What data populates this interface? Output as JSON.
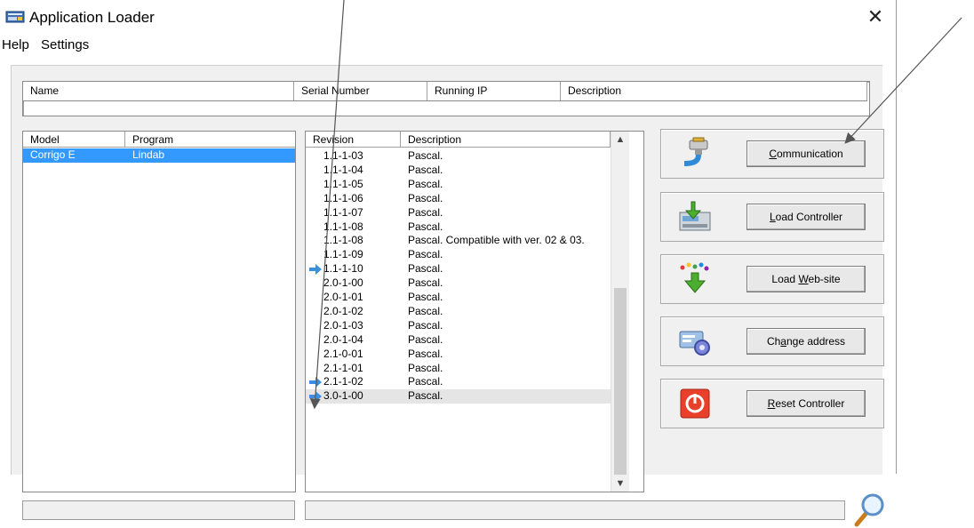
{
  "window": {
    "title": "Application Loader",
    "close_glyph": "✕"
  },
  "menu": [
    "Help",
    "Settings"
  ],
  "device_table": {
    "columns": [
      "Name",
      "Serial Number",
      "Running IP",
      "Description"
    ]
  },
  "model_table": {
    "columns": [
      "Model",
      "Program"
    ],
    "rows": [
      {
        "model": "Corrigo E",
        "program": "Lindab",
        "selected": true
      }
    ]
  },
  "revision_table": {
    "columns": [
      "Revision",
      "Description"
    ],
    "rows": [
      {
        "revision": "1.1-1-03",
        "description": "Pascal.",
        "arrow": false
      },
      {
        "revision": "1.1-1-04",
        "description": "Pascal.",
        "arrow": false
      },
      {
        "revision": "1.1-1-05",
        "description": "Pascal.",
        "arrow": false
      },
      {
        "revision": "1.1-1-06",
        "description": "Pascal.",
        "arrow": false
      },
      {
        "revision": "1.1-1-07",
        "description": "Pascal.",
        "arrow": false
      },
      {
        "revision": "1.1-1-08",
        "description": "Pascal.",
        "arrow": false
      },
      {
        "revision": "1.1-1-08",
        "description": "Pascal. Compatible with ver. 02 & 03.",
        "arrow": false
      },
      {
        "revision": "1.1-1-09",
        "description": "Pascal.",
        "arrow": false
      },
      {
        "revision": "1.1-1-10",
        "description": "Pascal.",
        "arrow": true
      },
      {
        "revision": "2.0-1-00",
        "description": "Pascal.",
        "arrow": false
      },
      {
        "revision": "2.0-1-01",
        "description": "Pascal.",
        "arrow": false
      },
      {
        "revision": "2.0-1-02",
        "description": "Pascal.",
        "arrow": false
      },
      {
        "revision": "2.0-1-03",
        "description": "Pascal.",
        "arrow": false
      },
      {
        "revision": "2.0-1-04",
        "description": "Pascal.",
        "arrow": false
      },
      {
        "revision": "2.1-0-01",
        "description": "Pascal.",
        "arrow": false
      },
      {
        "revision": "2.1-1-01",
        "description": "Pascal.",
        "arrow": false
      },
      {
        "revision": "2.1-1-02",
        "description": "Pascal.",
        "arrow": true
      },
      {
        "revision": "3.0-1-00",
        "description": "Pascal.",
        "arrow": true,
        "highlighted": true
      }
    ]
  },
  "buttons": [
    {
      "label": "Communication",
      "accel": "C",
      "icon": "cable-plug-icon",
      "pressed": false
    },
    {
      "label": "Load Controller",
      "accel": "L",
      "icon": "download-to-controller-icon",
      "pressed": false
    },
    {
      "label": "Load Web-site",
      "accel": "W",
      "icon": "web-download-icon",
      "pressed": false
    },
    {
      "label": "Change address",
      "accel": "a",
      "icon": "address-card-gear-icon",
      "pressed": false
    },
    {
      "label": "Reset Controller",
      "accel": "R",
      "icon": "power-reset-icon",
      "pressed": false
    }
  ],
  "colors": {
    "selection": "#3399ff",
    "arrow_blue": "#3b8fe0",
    "reset_red": "#e8402a",
    "green": "#4cae2e"
  },
  "icons": {
    "search": "magnifier-icon",
    "callout_arrows": "annotation-arrow"
  }
}
